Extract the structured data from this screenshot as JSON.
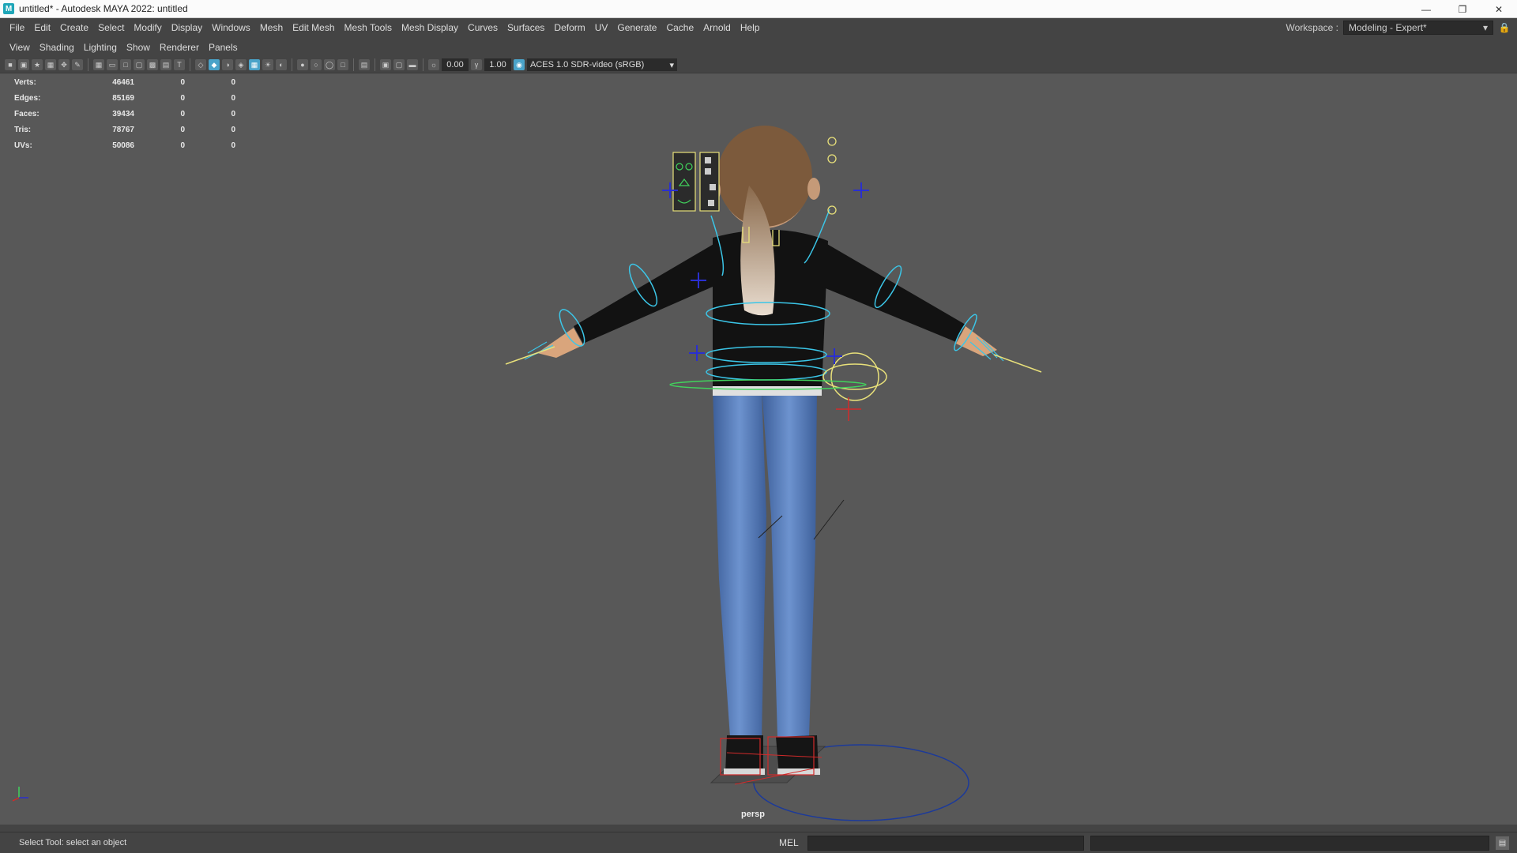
{
  "window": {
    "title": "untitled* - Autodesk MAYA 2022: untitled",
    "app_icon": "M"
  },
  "menubar": {
    "items": [
      "File",
      "Edit",
      "Create",
      "Select",
      "Modify",
      "Display",
      "Windows",
      "Mesh",
      "Edit Mesh",
      "Mesh Tools",
      "Mesh Display",
      "Curves",
      "Surfaces",
      "Deform",
      "UV",
      "Generate",
      "Cache",
      "Arnold",
      "Help"
    ],
    "workspace_label": "Workspace :",
    "workspace_value": "Modeling - Expert*"
  },
  "panel_menu": [
    "View",
    "Shading",
    "Lighting",
    "Show",
    "Renderer",
    "Panels"
  ],
  "panel_toolbar": {
    "exposure": "0.00",
    "gamma": "1.00",
    "color_space": "ACES 1.0 SDR-video (sRGB)"
  },
  "hud": {
    "rows": [
      {
        "label": "Verts:",
        "v1": "46461",
        "v2": "0",
        "v3": "0"
      },
      {
        "label": "Edges:",
        "v1": "85169",
        "v2": "0",
        "v3": "0"
      },
      {
        "label": "Faces:",
        "v1": "39434",
        "v2": "0",
        "v3": "0"
      },
      {
        "label": "Tris:",
        "v1": "78767",
        "v2": "0",
        "v3": "0"
      },
      {
        "label": "UVs:",
        "v1": "50086",
        "v2": "0",
        "v3": "0"
      }
    ]
  },
  "viewport": {
    "camera": "persp"
  },
  "status": {
    "help_line": "Select Tool: select an object",
    "command_lang": "MEL"
  },
  "colors": {
    "viewport_bg": "#585858",
    "control_cyan": "#3bc6e8",
    "control_yellow": "#e8e07a",
    "control_green": "#41d35c",
    "control_blue": "#2a2fd0",
    "control_red": "#d22a2a"
  }
}
